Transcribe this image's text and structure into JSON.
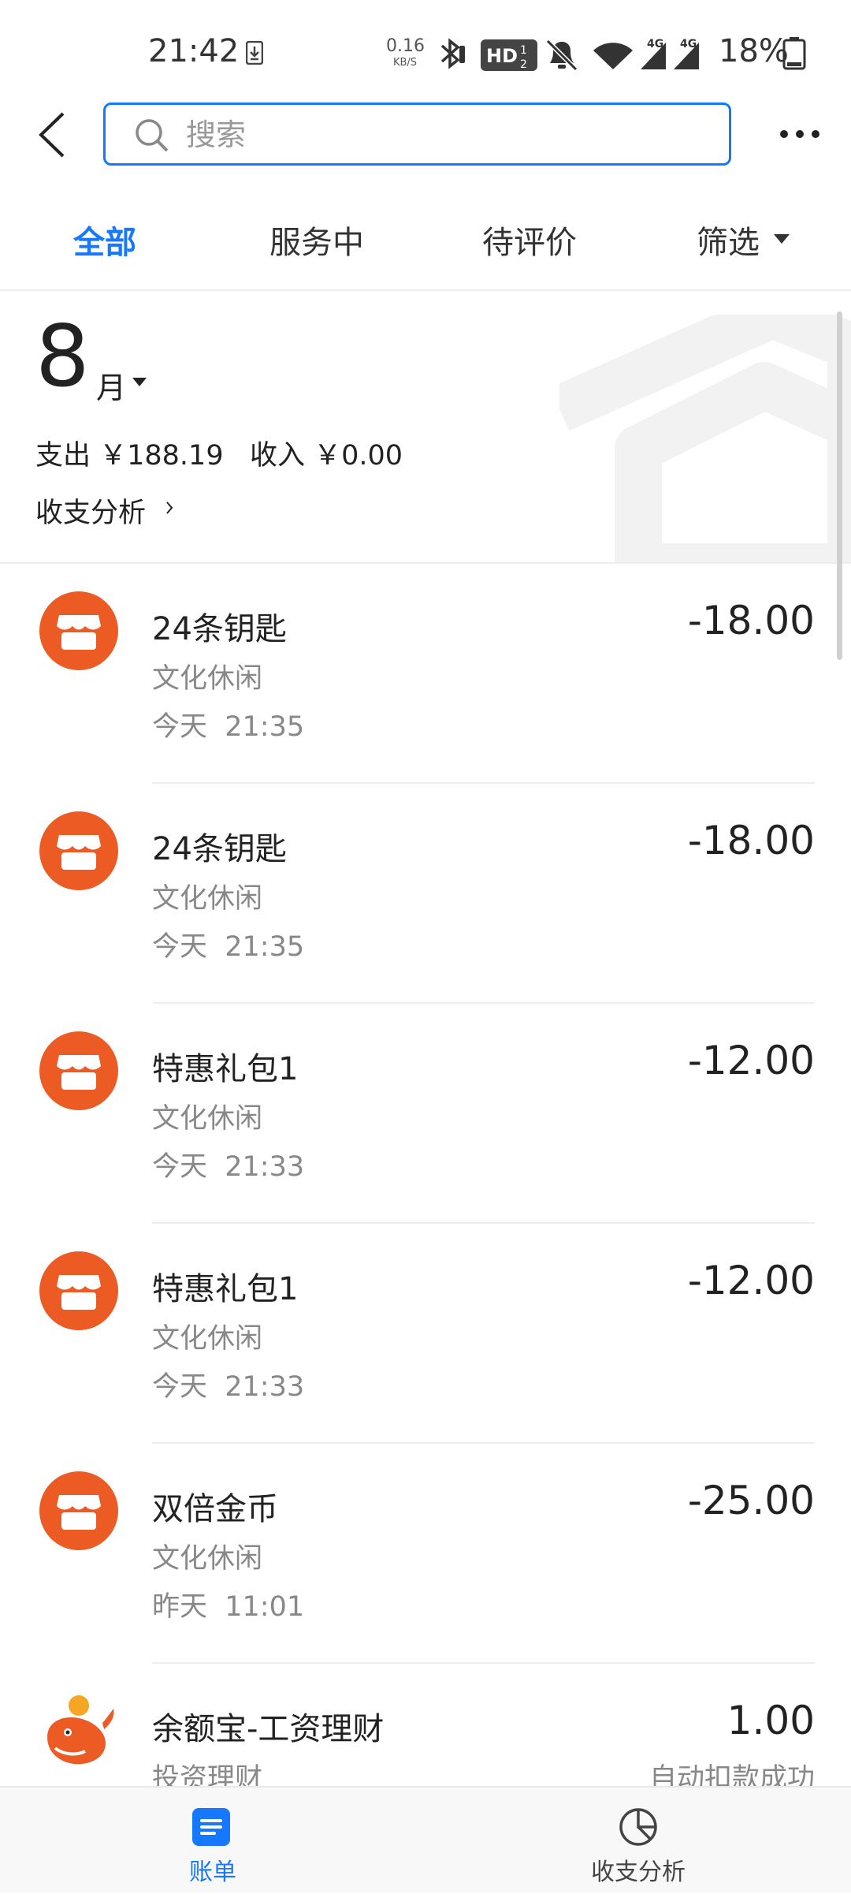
{
  "status_bar": {
    "time": "21:42",
    "net_speed": "0.16",
    "net_unit": "KB/S",
    "battery": "18%"
  },
  "header": {
    "search_placeholder": "搜索"
  },
  "tabs": [
    {
      "label": "全部",
      "active": true
    },
    {
      "label": "服务中",
      "active": false
    },
    {
      "label": "待评价",
      "active": false
    },
    {
      "label": "筛选",
      "active": false
    }
  ],
  "summary": {
    "month": "8",
    "month_unit": "月",
    "expense_line": "支出 ￥188.19   收入 ￥0.00",
    "analysis_link": "收支分析"
  },
  "transactions": [
    {
      "title": "24条钥匙",
      "category": "文化休闲",
      "time": "今天  21:35",
      "amount": "-18.00",
      "status": "",
      "icon": "store-icon"
    },
    {
      "title": "24条钥匙",
      "category": "文化休闲",
      "time": "今天  21:35",
      "amount": "-18.00",
      "status": "",
      "icon": "store-icon"
    },
    {
      "title": "特惠礼包1",
      "category": "文化休闲",
      "time": "今天  21:33",
      "amount": "-12.00",
      "status": "",
      "icon": "store-icon"
    },
    {
      "title": "特惠礼包1",
      "category": "文化休闲",
      "time": "今天  21:33",
      "amount": "-12.00",
      "status": "",
      "icon": "store-icon"
    },
    {
      "title": "双倍金币",
      "category": "文化休闲",
      "time": "昨天  11:01",
      "amount": "-25.00",
      "status": "",
      "icon": "store-icon"
    },
    {
      "title": "余额宝-工资理财",
      "category": "投资理财",
      "time": "",
      "amount": "1.00",
      "status": "自动扣款成功",
      "icon": "yuebao-icon"
    }
  ],
  "bottom_nav": [
    {
      "label": "账单",
      "active": true,
      "icon": "bill-icon"
    },
    {
      "label": "收支分析",
      "active": false,
      "icon": "pie-chart-icon"
    }
  ],
  "colors": {
    "accent": "#1677ff",
    "store_icon": "#ec5b24"
  }
}
